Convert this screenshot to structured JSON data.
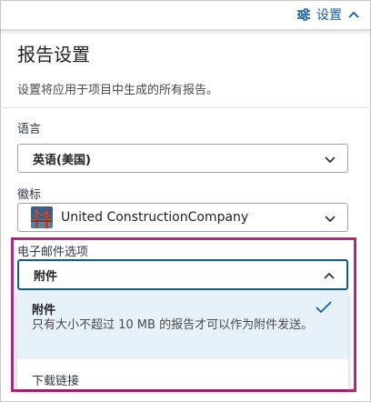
{
  "header": {
    "settings_label": "设置"
  },
  "panel": {
    "title": "报告设置",
    "description": "设置将应用于项目中生成的所有报告。"
  },
  "language": {
    "label": "语言",
    "value": "英语(美国)"
  },
  "logo": {
    "label": "徽标",
    "value": "United ConstructionCompany"
  },
  "email": {
    "label": "电子邮件选项",
    "value": "附件",
    "options": [
      {
        "title": "附件",
        "description": "只有大小不超过 10 MB 的报告才可以作为附件发送。",
        "selected": true
      },
      {
        "title": "下载链接",
        "selected": false
      }
    ]
  },
  "colors": {
    "accent": "#0b5ca8",
    "highlight": "#b0297a",
    "selected_bg": "#e6f1fa"
  },
  "icons": [
    "sliders-icon",
    "chevron-up-icon",
    "chevron-down-icon",
    "checkmark-icon",
    "golden-gate-bridge-logo"
  ]
}
